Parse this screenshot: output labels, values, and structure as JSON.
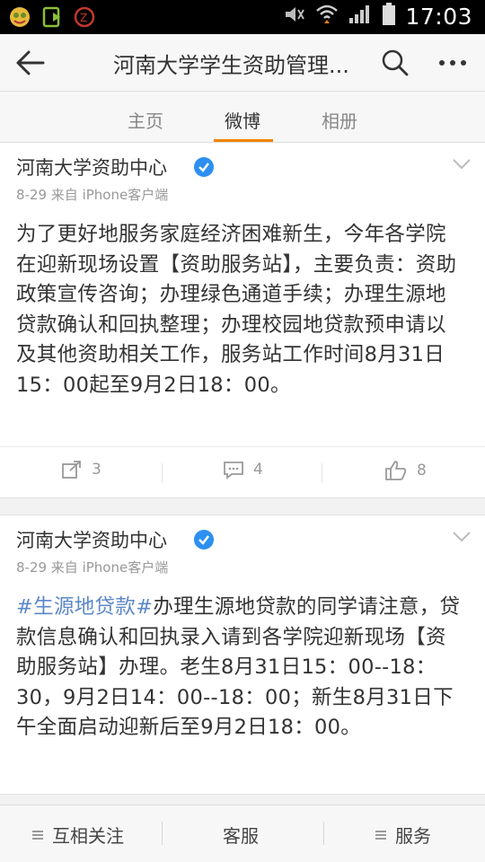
{
  "status_bar": {
    "time": "17:03"
  },
  "header": {
    "title": "河南大学学生资助管理..."
  },
  "tabs": [
    {
      "label": "主页"
    },
    {
      "label": "微博"
    },
    {
      "label": "相册"
    }
  ],
  "posts": [
    {
      "author": "河南大学资助中心",
      "meta": "8-29  来自 iPhone客户端",
      "hashtag": "",
      "text": "为了更好地服务家庭经济困难新生，今年各学院在迎新现场设置【资助服务站】，主要负责：资助政策宣传咨询；办理绿色通道手续；办理生源地贷款确认和回执整理；办理校园地贷款预申请以及其他资助相关工作，服务站工作时间8月31日15：00起至9月2日18：00。",
      "reposts": "3",
      "comments": "4",
      "likes": "8"
    },
    {
      "author": "河南大学资助中心",
      "meta": "8-29  来自 iPhone客户端",
      "hashtag": "#生源地贷款#",
      "text": "办理生源地贷款的同学请注意，贷款信息确认和回执录入请到各学院迎新现场【资助服务站】办理。老生8月31日15：00--18：30，9月2日14：00--18：00；新生8月31日下午全面启动迎新后至9月2日18：00。"
    }
  ],
  "bottom_bar": {
    "follow": "互相关注",
    "service": "客服",
    "services": "服务"
  },
  "colors": {
    "accent": "#f08200",
    "verified": "#2d8ff0",
    "hashtag": "#5b88c6"
  }
}
